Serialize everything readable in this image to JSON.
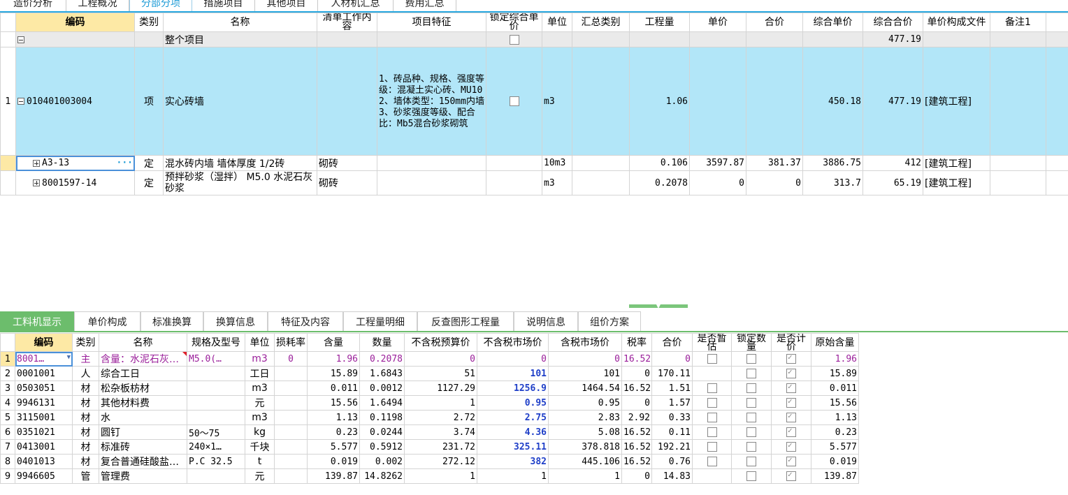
{
  "top_tabs": [
    "造价分析",
    "工程概况",
    "分部分项",
    "措施项目",
    "其他项目",
    "人材机汇总",
    "费用汇总"
  ],
  "top_active": 2,
  "upper": {
    "headers": [
      "编码",
      "类别",
      "名称",
      "清单工作内容",
      "项目特征",
      "锁定综合单价",
      "单位",
      "汇总类别",
      "工程量",
      "单价",
      "合价",
      "综合单价",
      "综合合价",
      "单价构成文件",
      "备注1"
    ],
    "total_row": {
      "name": "整个项目",
      "combined_total": "477.19"
    },
    "item_row": {
      "no": "1",
      "code": "010401003004",
      "type": "项",
      "name": "实心砖墙",
      "features": "1、砖品种、规格、强度等级：混凝土实心砖、MU10\n2、墙体类型：150mm内墙\n3、砂浆强度等级、配合比：Mb5混合砂浆砌筑",
      "unit": "m3",
      "quantity": "1.06",
      "combined_unit_price": "450.18",
      "combined_total": "477.19",
      "price_file": "[建筑工程]"
    },
    "sub_rows": [
      {
        "code": "A3-13",
        "type": "定",
        "name": "混水砖内墙 墙体厚度 1/2砖",
        "work": "砌砖",
        "unit": "10m3",
        "quantity": "0.106",
        "unit_price": "3597.87",
        "total": "381.37",
        "combined_unit_price": "3886.75",
        "combined_total": "412",
        "price_file": "[建筑工程]"
      },
      {
        "code": "8001597-14",
        "type": "定",
        "name": "预拌砂浆（湿拌） M5.0 水泥石灰砂浆",
        "work": "砌砖",
        "unit": "m3",
        "quantity": "0.2078",
        "unit_price": "0",
        "total": "0",
        "combined_unit_price": "313.7",
        "combined_total": "65.19",
        "price_file": "[建筑工程]"
      }
    ]
  },
  "bottom_tabs": [
    "工料机显示",
    "单价构成",
    "标准换算",
    "换算信息",
    "特征及内容",
    "工程量明细",
    "反查图形工程量",
    "说明信息",
    "组价方案"
  ],
  "bottom_active": 0,
  "lower": {
    "headers": [
      "编码",
      "类别",
      "名称",
      "规格及型号",
      "单位",
      "损耗率",
      "含量",
      "数量",
      "不含税预算价",
      "不含税市场价",
      "含税市场价",
      "税率",
      "合价",
      "是否暂估",
      "锁定数量",
      "是否计价",
      "原始含量"
    ],
    "rows": [
      {
        "no": "1",
        "code": "8001…",
        "type": "主",
        "name": "含量：水泥石灰…",
        "spec": "M5.0(…",
        "unit": "m3",
        "loss": "0",
        "content": "1.96",
        "qty": "0.2078",
        "budget": "0",
        "market": "0",
        "market_tax": "0",
        "tax": "16.52",
        "total": "0",
        "orig": "1.96"
      },
      {
        "no": "2",
        "code": "0001001",
        "type": "人",
        "name": "综合工日",
        "spec": "",
        "unit": "工日",
        "loss": "",
        "content": "15.89",
        "qty": "1.6843",
        "budget": "51",
        "market": "101",
        "market_tax": "101",
        "tax": "0",
        "total": "170.11",
        "orig": "15.89"
      },
      {
        "no": "3",
        "code": "0503051",
        "type": "材",
        "name": "松杂板枋材",
        "spec": "",
        "unit": "m3",
        "loss": "",
        "content": "0.011",
        "qty": "0.0012",
        "budget": "1127.29",
        "market": "1256.9",
        "market_tax": "1464.54",
        "tax": "16.52",
        "total": "1.51",
        "orig": "0.011"
      },
      {
        "no": "4",
        "code": "9946131",
        "type": "材",
        "name": "其他材料费",
        "spec": "",
        "unit": "元",
        "loss": "",
        "content": "15.56",
        "qty": "1.6494",
        "budget": "1",
        "market": "0.95",
        "market_tax": "0.95",
        "tax": "0",
        "total": "1.57",
        "orig": "15.56"
      },
      {
        "no": "5",
        "code": "3115001",
        "type": "材",
        "name": "水",
        "spec": "",
        "unit": "m3",
        "loss": "",
        "content": "1.13",
        "qty": "0.1198",
        "budget": "2.72",
        "market": "2.75",
        "market_tax": "2.83",
        "tax": "2.92",
        "total": "0.33",
        "orig": "1.13"
      },
      {
        "no": "6",
        "code": "0351021",
        "type": "材",
        "name": "圆钉",
        "spec": "50～75",
        "unit": "kg",
        "loss": "",
        "content": "0.23",
        "qty": "0.0244",
        "budget": "3.74",
        "market": "4.36",
        "market_tax": "5.08",
        "tax": "16.52",
        "total": "0.11",
        "orig": "0.23"
      },
      {
        "no": "7",
        "code": "0413001",
        "type": "材",
        "name": "标准砖",
        "spec": "240×1…",
        "unit": "千块",
        "loss": "",
        "content": "5.577",
        "qty": "0.5912",
        "budget": "231.72",
        "market": "325.11",
        "market_tax": "378.818",
        "tax": "16.52",
        "total": "192.21",
        "orig": "5.577"
      },
      {
        "no": "8",
        "code": "0401013",
        "type": "材",
        "name": "复合普通硅酸盐…",
        "spec": "P.C 32.5",
        "unit": "t",
        "loss": "",
        "content": "0.019",
        "qty": "0.002",
        "budget": "272.12",
        "market": "382",
        "market_tax": "445.106",
        "tax": "16.52",
        "total": "0.76",
        "orig": "0.019"
      },
      {
        "no": "9",
        "code": "9946605",
        "type": "管",
        "name": "管理费",
        "spec": "",
        "unit": "元",
        "loss": "",
        "content": "139.87",
        "qty": "14.8262",
        "budget": "1",
        "market": "1",
        "market_tax": "1",
        "tax": "0",
        "total": "14.83",
        "orig": "139.87"
      }
    ]
  }
}
